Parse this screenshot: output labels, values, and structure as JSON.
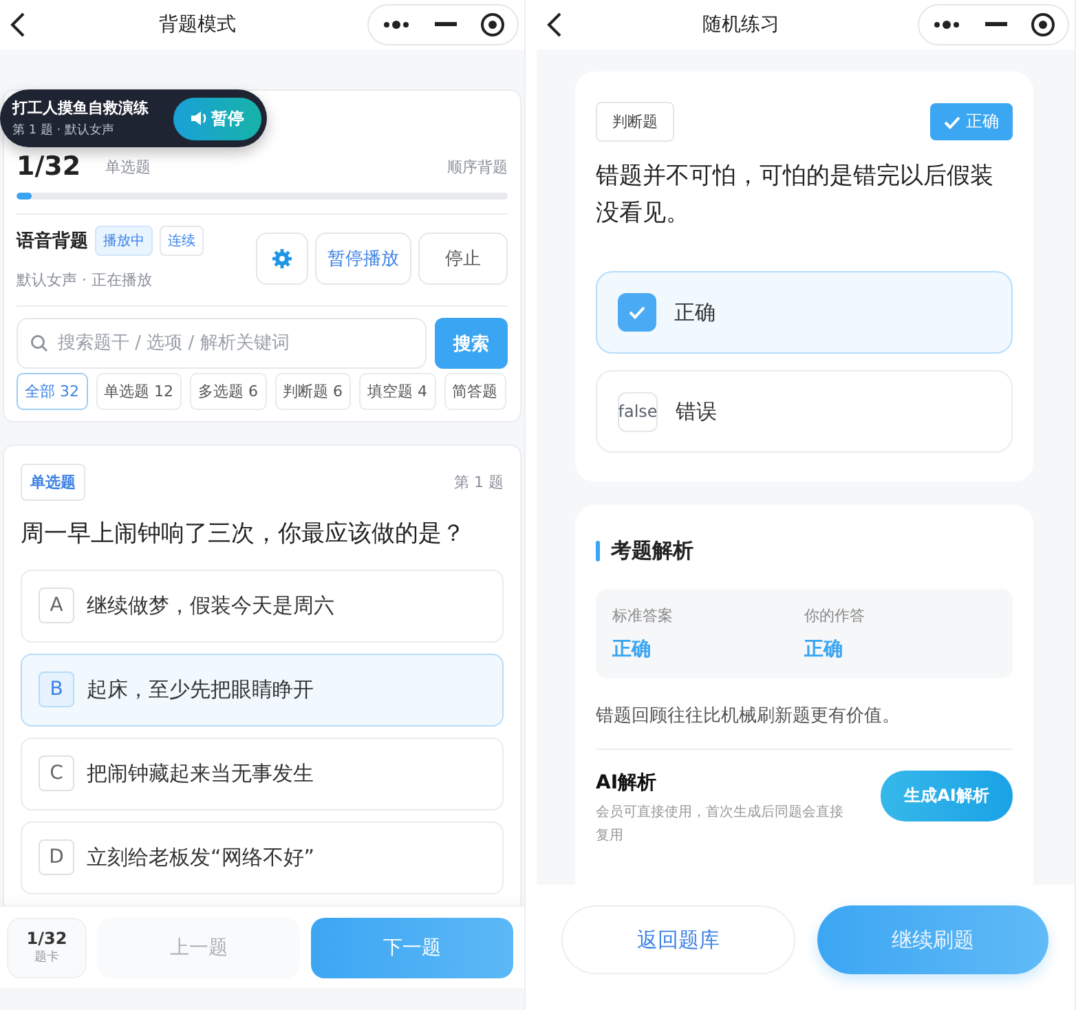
{
  "left": {
    "header": {
      "title": "背题模式"
    },
    "floating_player": {
      "title": "打工人摸鱼自救演练",
      "subtitle": "第 1 题 · 默认女声",
      "button": "暂停"
    },
    "progress": {
      "counter": "1/32",
      "type": "单选题",
      "mode": "顺序背题",
      "level": 0.03
    },
    "voice": {
      "title": "语音背题",
      "tags": [
        {
          "label": "播放中",
          "selected": true
        },
        {
          "label": "连续",
          "selected": false
        }
      ],
      "status": "默认女声 · 正在播放",
      "buttons": [
        {
          "label": "暂停播放",
          "kind": "primary"
        },
        {
          "label": "停止",
          "kind": "plain"
        }
      ]
    },
    "search": {
      "placeholder": "搜索题干 / 选项 / 解析关键词",
      "button": "搜索"
    },
    "filters": [
      {
        "label": "全部 32",
        "selected": true
      },
      {
        "label": "单选题 12",
        "selected": false
      },
      {
        "label": "多选题 6",
        "selected": false
      },
      {
        "label": "判断题 6",
        "selected": false
      },
      {
        "label": "填空题 4",
        "selected": false
      },
      {
        "label": "简答题",
        "selected": false
      }
    ],
    "question": {
      "type": "单选题",
      "number": "第 1 题",
      "text": "周一早上闹钟响了三次，你最应该做的是？",
      "options": [
        {
          "letter": "A",
          "text": "继续做梦，假装今天是周六",
          "selected": false
        },
        {
          "letter": "B",
          "text": "起床，至少先把眼睛睁开",
          "selected": true
        },
        {
          "letter": "C",
          "text": "把闹钟藏起来当无事发生",
          "selected": false
        },
        {
          "letter": "D",
          "text": "立刻给老板发“网络不好”",
          "selected": false
        }
      ]
    },
    "footer": {
      "counter": "1/32",
      "card_label": "题卡",
      "prev": {
        "label": "上一题",
        "disabled": true
      },
      "next": "下一题"
    }
  },
  "right": {
    "header": {
      "title": "随机练习"
    },
    "question": {
      "type": "判断题",
      "result": "正确",
      "text": "错题并不可怕，可怕的是错完以后假装没看见。",
      "options": [
        {
          "text": "正确",
          "selected": true
        },
        {
          "marker": "false",
          "text": "错误",
          "selected": false
        }
      ]
    },
    "analysis": {
      "title": "考题解析",
      "answers": [
        {
          "label": "标准答案",
          "value": "正确"
        },
        {
          "label": "你的作答",
          "value": "正确"
        }
      ],
      "note": "错题回顾往往比机械刷新题更有价值。",
      "ai": {
        "title": "AI解析",
        "description": "会员可直接使用，首次生成后同题会直接复用",
        "button": "生成AI解析"
      }
    },
    "footer": {
      "back": "返回题库",
      "continue": "继续刷题"
    }
  }
}
